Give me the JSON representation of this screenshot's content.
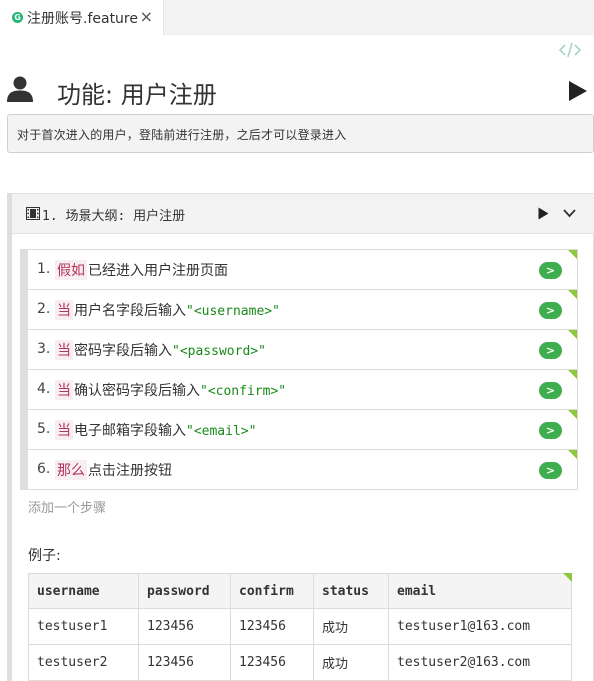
{
  "tab": {
    "title": "注册账号.feature",
    "close": "×"
  },
  "feature": {
    "title": "功能: 用户注册",
    "description": "对于首次进入的用户，登陆前进行注册，之后才可以登录进入"
  },
  "scenario": {
    "title": "1. 场景大纲: 用户注册",
    "steps": [
      {
        "num": "1.",
        "keyword": "假如",
        "text": "已经进入用户注册页面",
        "param": ""
      },
      {
        "num": "2.",
        "keyword": "当",
        "text": "用户名字段后输入",
        "param": "\"<username>\""
      },
      {
        "num": "3.",
        "keyword": "当",
        "text": "密码字段后输入",
        "param": "\"<password>\""
      },
      {
        "num": "4.",
        "keyword": "当",
        "text": "确认密码字段后输入",
        "param": "\"<confirm>\""
      },
      {
        "num": "5.",
        "keyword": "当",
        "text": "电子邮箱字段输入",
        "param": "\"<email>\""
      },
      {
        "num": "6.",
        "keyword": "那么",
        "text": "点击注册按钮",
        "param": ""
      }
    ],
    "step_button": ">",
    "add_step": "添加一个步骤",
    "examples_label": "例子:",
    "examples": {
      "headers": [
        "username",
        "password",
        "confirm",
        "status",
        "email"
      ],
      "rows": [
        [
          "testuser1",
          "123456",
          "123456",
          "成功",
          "testuser1@163.com"
        ],
        [
          "testuser2",
          "123456",
          "123456",
          "成功",
          "testuser2@163.com"
        ]
      ]
    }
  },
  "colors": {
    "accent_green": "#3fae4e",
    "keyword": "#b5345a",
    "param": "#1a8a1a"
  },
  "icons": [
    "feature-file-icon",
    "close-icon",
    "code-view-icon",
    "user-icon",
    "play-icon",
    "film-icon",
    "chevron-down-icon"
  ]
}
